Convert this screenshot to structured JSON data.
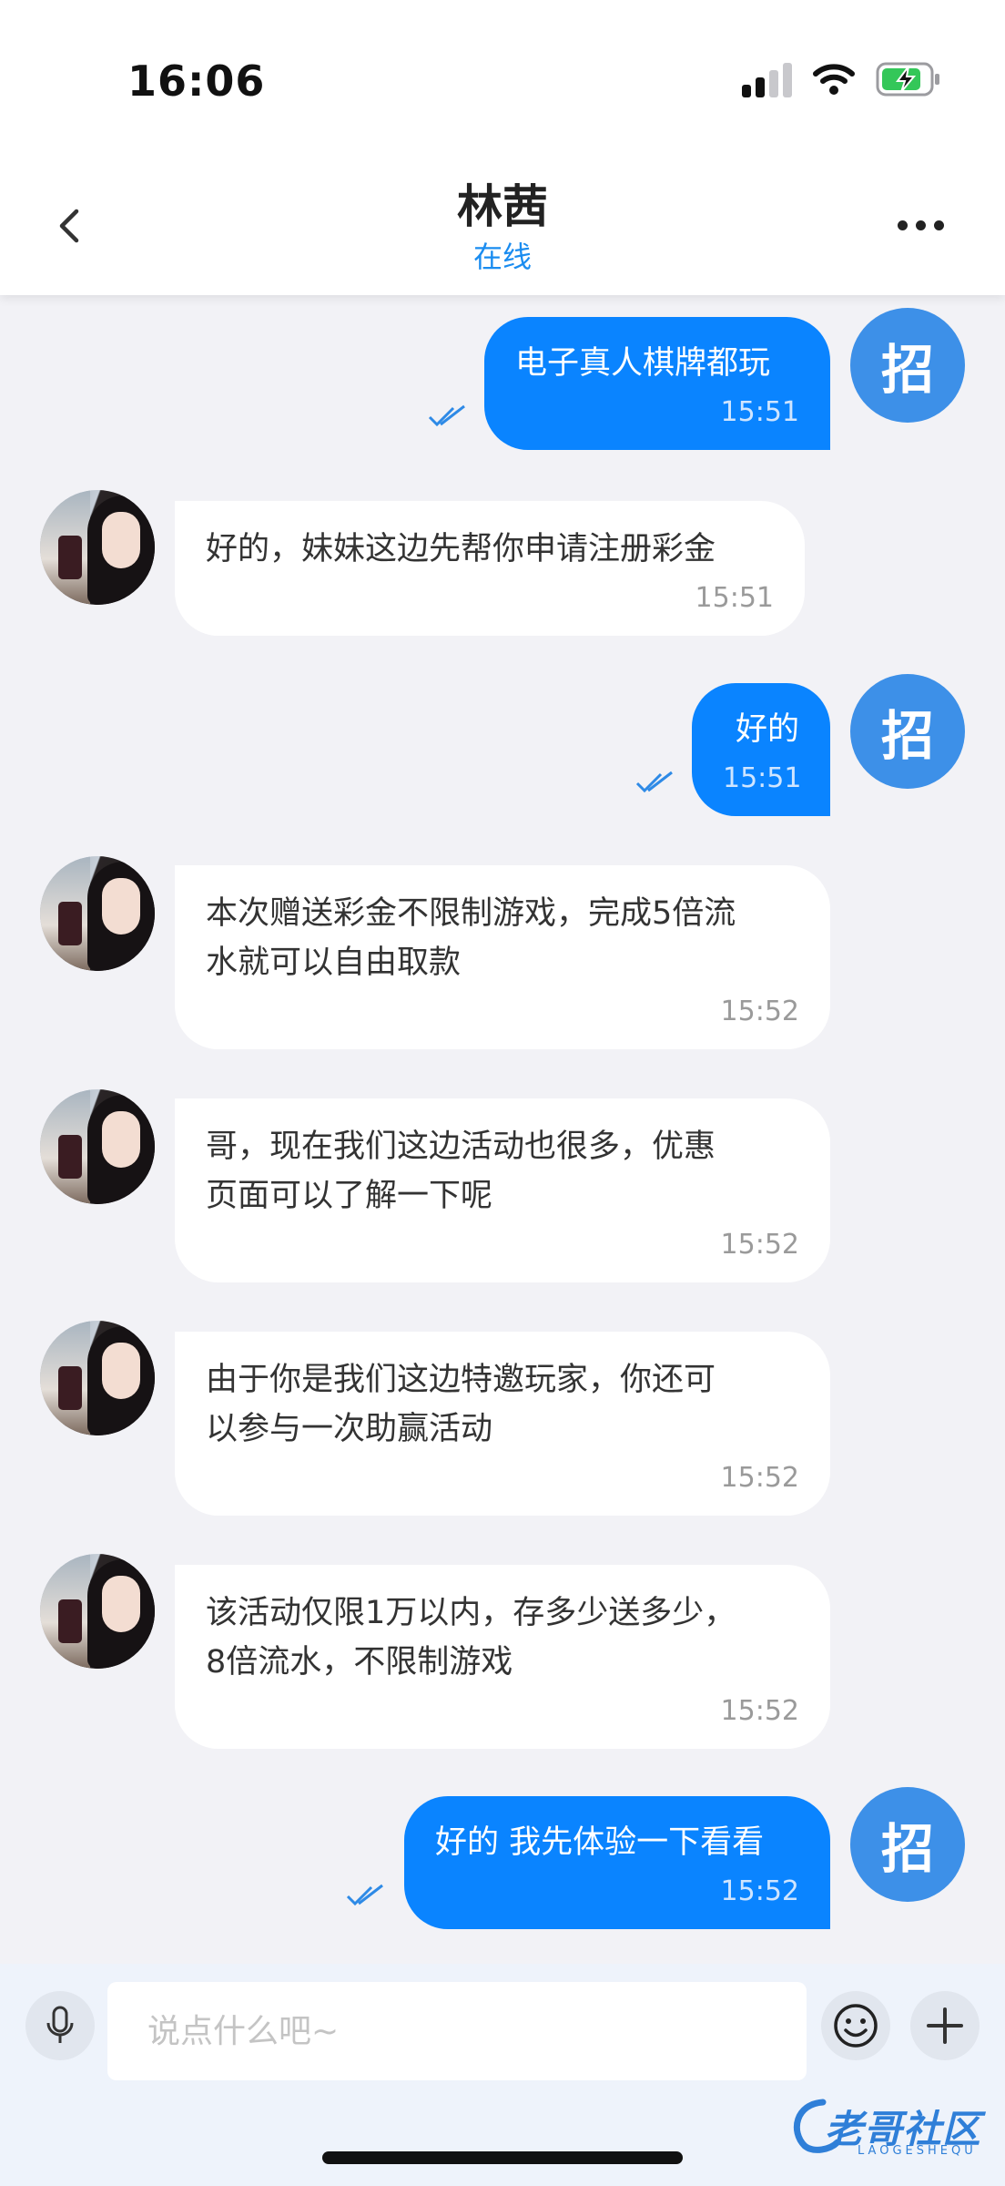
{
  "status_bar": {
    "time": "16:06"
  },
  "header": {
    "name": "林茜",
    "status": "在线"
  },
  "self_avatar_text": "招",
  "messages": [
    {
      "side": "self",
      "text": "电子真人棋牌都玩",
      "time": "15:51",
      "read": true
    },
    {
      "side": "other",
      "text": "好的，妹妹这边先帮你申请注册彩金",
      "time": "15:51"
    },
    {
      "side": "self",
      "text": "好的",
      "time": "15:51",
      "read": true
    },
    {
      "side": "other",
      "text": "本次赠送彩金不限制游戏，完成5倍流\n水就可以自由取款",
      "time": "15:52"
    },
    {
      "side": "other",
      "text": "哥，现在我们这边活动也很多，优惠\n页面可以了解一下呢",
      "time": "15:52"
    },
    {
      "side": "other",
      "text": "由于你是我们这边特邀玩家，你还可\n以参与一次助赢活动",
      "time": "15:52"
    },
    {
      "side": "other",
      "text": "该活动仅限1万以内，存多少送多少，\n8倍流水，不限制游戏",
      "time": "15:52"
    },
    {
      "side": "self",
      "text": "好的 我先体验一下看看",
      "time": "15:52",
      "read": true
    }
  ],
  "input": {
    "placeholder": "说点什么吧~",
    "value": ""
  },
  "watermark": {
    "text": "老哥社区",
    "sub": "LAOGESHEQU"
  },
  "colors": {
    "accent": "#0a84ff",
    "avatar_self": "#3d90e8",
    "online": "#1a8cf0"
  },
  "icons": [
    "back-chevron-icon",
    "more-dots-icon",
    "double-check-icon",
    "microphone-icon",
    "emoji-icon",
    "plus-icon"
  ]
}
